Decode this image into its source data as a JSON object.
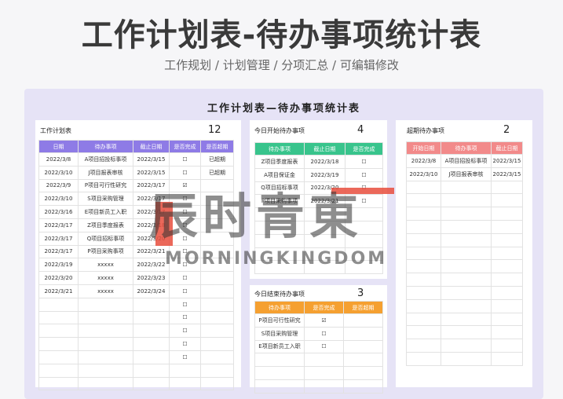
{
  "header": {
    "title": "工作计划表-待办事项统计表",
    "subtitle": "工作规划 / 计划管理 / 分项汇总 / 可编辑修改"
  },
  "sheet": {
    "title": "工作计划表—待办事项统计表"
  },
  "plan": {
    "title": "工作计划表",
    "count": "12",
    "columns": [
      "日期",
      "待办事项",
      "截止日期",
      "是否完成",
      "是否超期"
    ],
    "rows": [
      [
        "2022/3/8",
        "A项目招投标事项",
        "2022/3/15",
        "☐",
        "已超期"
      ],
      [
        "2022/3/10",
        "J项目报表审核",
        "2022/3/15",
        "☐",
        "已超期"
      ],
      [
        "2022/3/9",
        "P项目可行性研究",
        "2022/3/17",
        "☑",
        ""
      ],
      [
        "2022/3/10",
        "S项目采购管理",
        "2022/3/17",
        "☐",
        ""
      ],
      [
        "2022/3/16",
        "E项目新员工入职",
        "2022/3/17",
        "☐",
        ""
      ],
      [
        "2022/3/17",
        "Z项目季度报表",
        "2022/3/18",
        "☐",
        ""
      ],
      [
        "2022/3/17",
        "Q项目招标事项",
        "2022/3/20",
        "☐",
        ""
      ],
      [
        "2022/3/17",
        "P项目采购事项",
        "2022/3/21",
        "☐",
        ""
      ],
      [
        "2022/3/19",
        "xxxxx",
        "2022/3/22",
        "☐",
        ""
      ],
      [
        "2022/3/20",
        "xxxxx",
        "2022/3/23",
        "☐",
        ""
      ],
      [
        "2022/3/21",
        "xxxxx",
        "2022/3/24",
        "☐",
        ""
      ],
      [
        "",
        "",
        "",
        "☐",
        ""
      ],
      [
        "",
        "",
        "",
        "☐",
        ""
      ],
      [
        "",
        "",
        "",
        "☐",
        ""
      ],
      [
        "",
        "",
        "",
        "☐",
        ""
      ],
      [
        "",
        "",
        "",
        "☐",
        ""
      ],
      [
        "",
        "",
        "",
        "",
        ""
      ],
      [
        "",
        "",
        "",
        "",
        ""
      ]
    ]
  },
  "today_start": {
    "title": "今日开始待办事项",
    "count": "4",
    "columns": [
      "待办事项",
      "截止日期",
      "是否完成"
    ],
    "rows": [
      [
        "Z项目季度报表",
        "2022/3/18",
        "☐"
      ],
      [
        "A项目保证金",
        "2022/3/19",
        "☐"
      ],
      [
        "Q项目招标事项",
        "2022/3/20",
        "☐"
      ],
      [
        "P项目采购事项",
        "2022/3/21",
        "☐"
      ],
      [
        "",
        "",
        ""
      ],
      [
        "",
        "",
        ""
      ],
      [
        "",
        "",
        ""
      ],
      [
        "",
        "",
        ""
      ],
      [
        "",
        "",
        ""
      ]
    ]
  },
  "today_end": {
    "title": "今日结束待办事项",
    "count": "3",
    "columns": [
      "待办事项",
      "是否完成",
      "是否超期"
    ],
    "rows": [
      [
        "P项目可行性研究",
        "☑",
        ""
      ],
      [
        "S项目采购管理",
        "☐",
        ""
      ],
      [
        "E项目新员工入职",
        "☐",
        ""
      ],
      [
        "",
        "",
        ""
      ],
      [
        "",
        "",
        ""
      ],
      [
        "",
        "",
        ""
      ]
    ]
  },
  "overdue": {
    "title": "超期待办事项",
    "count": "2",
    "columns": [
      "开始日期",
      "待办事项",
      "截止日期"
    ],
    "rows": [
      [
        "2022/3/8",
        "A项目招投标事项",
        "2022/3/15"
      ],
      [
        "2022/3/10",
        "J项目报表审核",
        "2022/3/15"
      ],
      [
        "",
        "",
        ""
      ],
      [
        "",
        "",
        ""
      ],
      [
        "",
        "",
        ""
      ],
      [
        "",
        "",
        ""
      ],
      [
        "",
        "",
        ""
      ],
      [
        "",
        "",
        ""
      ],
      [
        "",
        "",
        ""
      ],
      [
        "",
        "",
        ""
      ],
      [
        "",
        "",
        ""
      ],
      [
        "",
        "",
        ""
      ],
      [
        "",
        "",
        ""
      ],
      [
        "",
        "",
        ""
      ],
      [
        "",
        "",
        ""
      ],
      [
        "",
        "",
        ""
      ]
    ]
  },
  "watermark": {
    "brand": "辰时青東",
    "latin": "MORNINGKINGDOM"
  }
}
